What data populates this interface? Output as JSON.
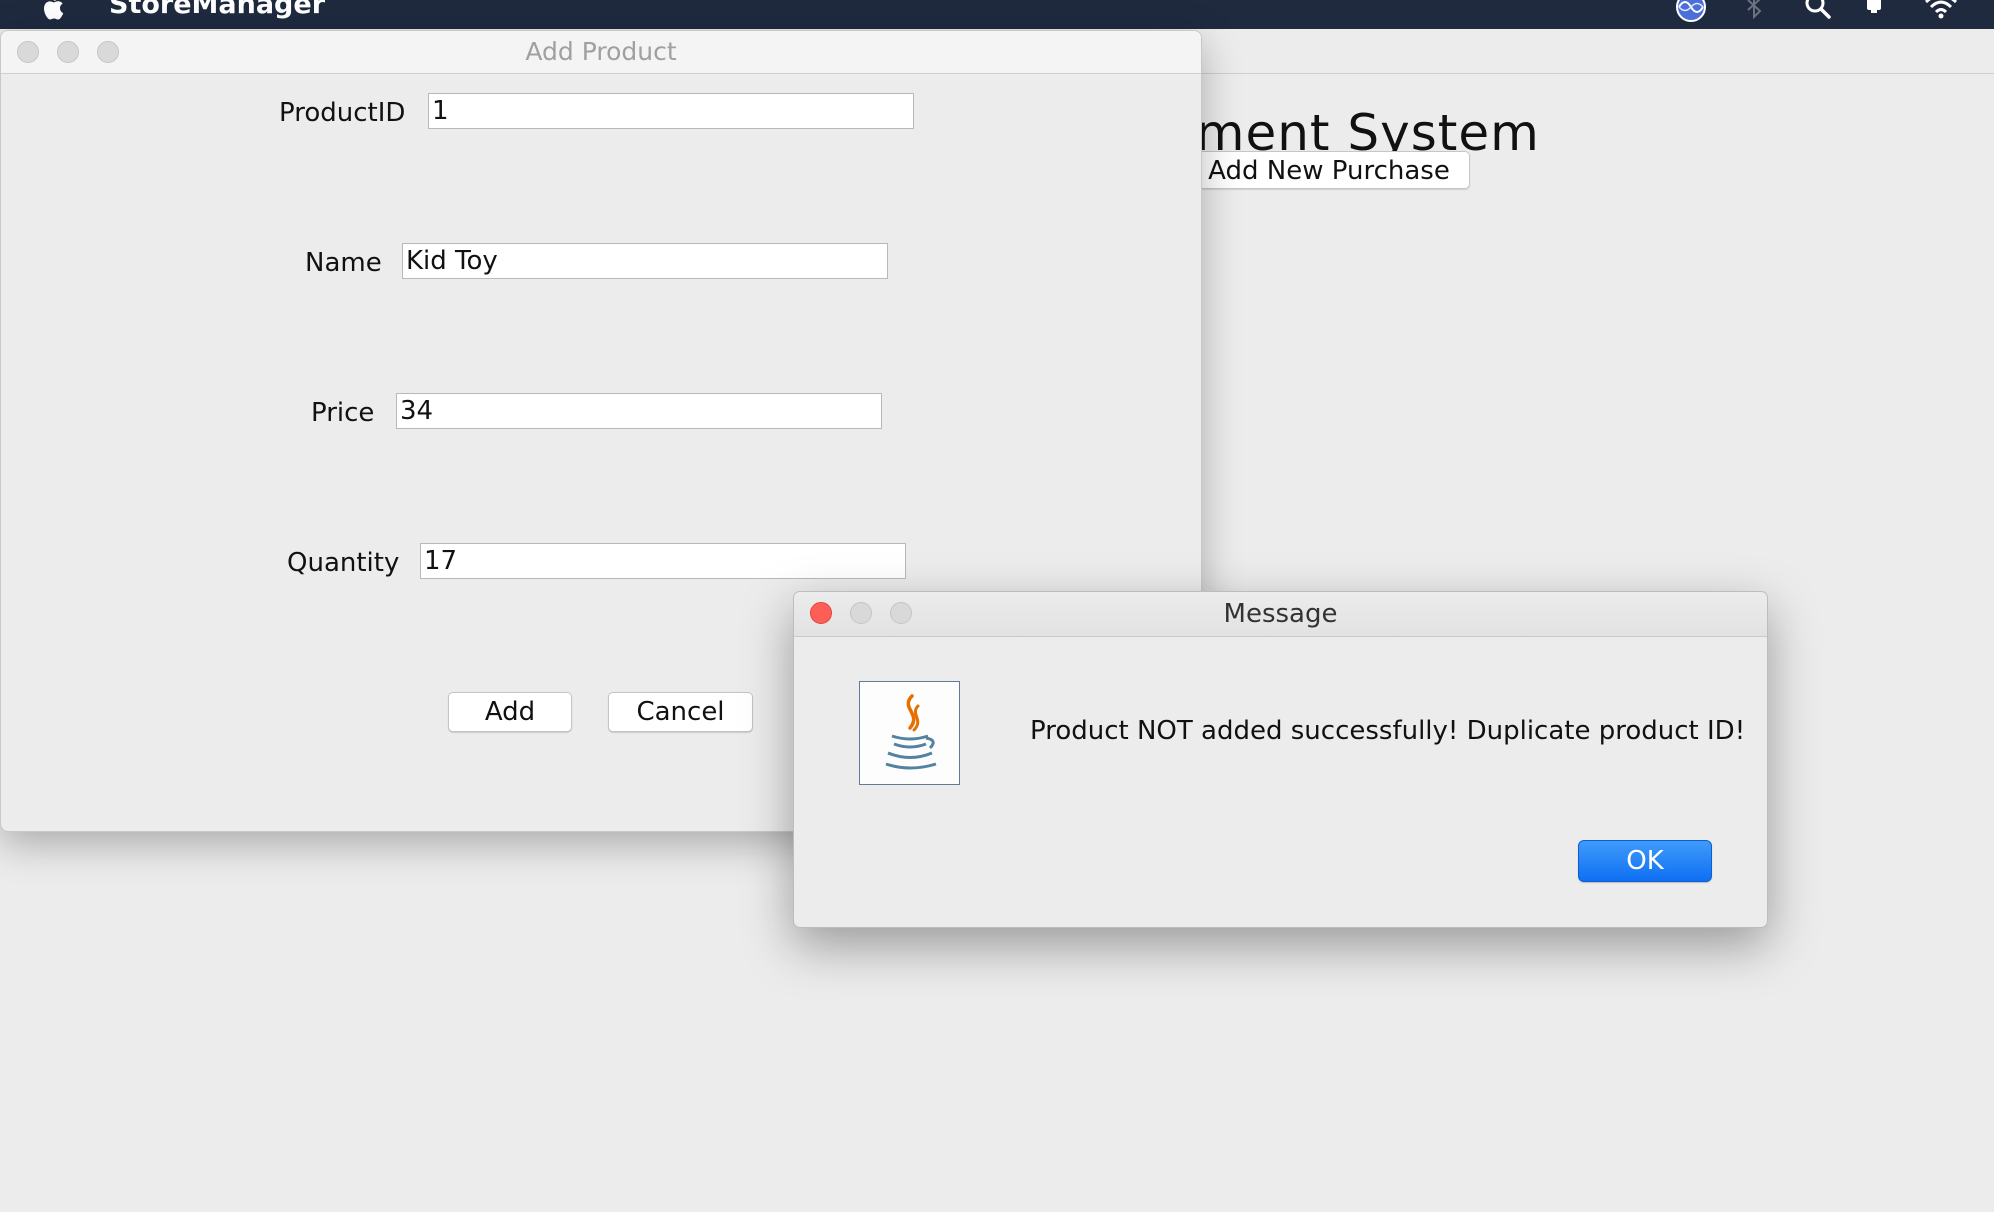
{
  "menubar": {
    "app_name": "StoreManager",
    "status_icons": [
      "siri-icon",
      "bluetooth-icon",
      "search-icon",
      "notifications-icon",
      "wifi-icon"
    ]
  },
  "main_window": {
    "heading": "ement System",
    "add_purchase_button": "Add New Purchase"
  },
  "add_product": {
    "title": "Add Product",
    "fields": {
      "product_id": {
        "label": "ProductID",
        "value": "1"
      },
      "name": {
        "label": "Name",
        "value": "Kid Toy"
      },
      "price": {
        "label": "Price",
        "value": "34"
      },
      "quantity": {
        "label": "Quantity",
        "value": "17"
      }
    },
    "add_button": "Add",
    "cancel_button": "Cancel"
  },
  "message": {
    "title": "Message",
    "text": "Product NOT added successfully! Duplicate product ID!",
    "ok_button": "OK",
    "icon": "java-icon"
  },
  "colors": {
    "menubar": "#1f2a3f",
    "ok_button": "#1473f3",
    "close_button": "#fd5f57",
    "java_orange": "#e76f00",
    "java_blue": "#5382a1"
  }
}
